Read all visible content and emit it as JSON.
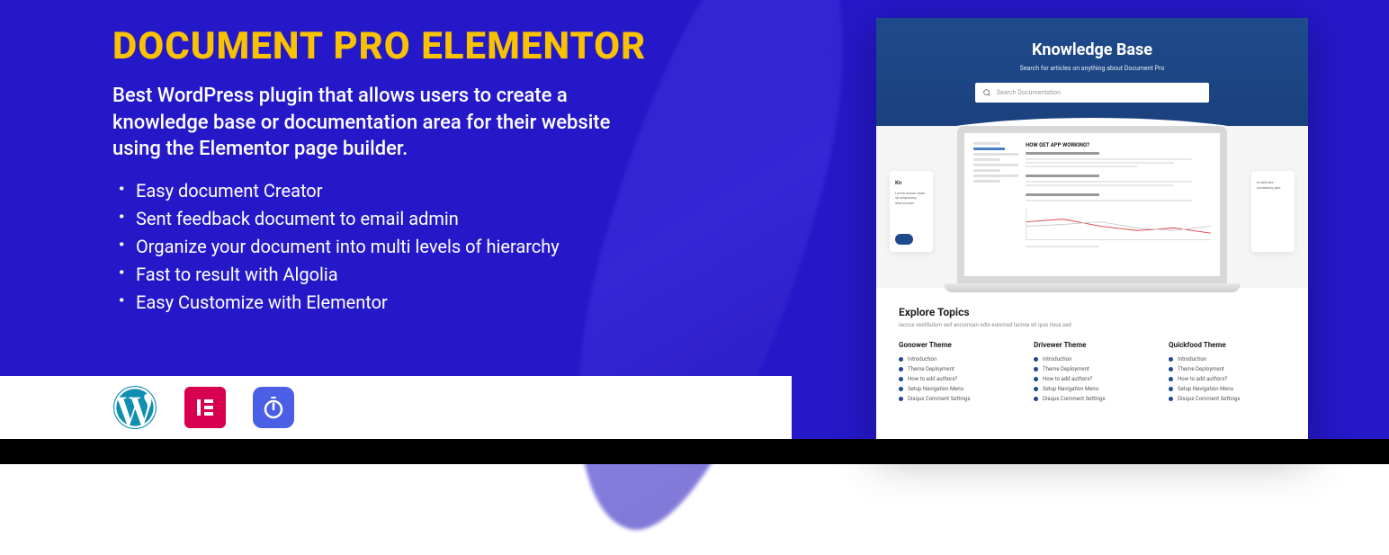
{
  "hero": {
    "title": "DOCUMENT PRO ELEMENTOR",
    "subtitle": "Best WordPress plugin that allows users to create  a knowledge base or documentation area for their website using the Elementor page builder.",
    "features": [
      "Easy document Creator",
      "Sent feedback document to email admin",
      "Organize your document into multi levels of hierarchy",
      "Fast to result with Algolia",
      "Easy Customize with Elementor"
    ]
  },
  "preview": {
    "kb_title": "Knowledge Base",
    "kb_subtitle": "Search for articles on anything about Document Pro",
    "search_placeholder": "Search Documentation",
    "left_card": {
      "title": "Kn",
      "text": "Lorem ipsum dolor sit adipiscing ullamcorper"
    },
    "right_card": {
      "text": "ts with the containing ges."
    },
    "article_title": "HOW GET APP WORKING?",
    "explore": {
      "title": "Explore Topics",
      "subtitle": "Iaccus vestibulum sed accumsan odio euismod lacinia sit quis risus sed",
      "columns": [
        {
          "title": "Gonower Theme",
          "items": [
            "Introduction",
            "Theme Deployment",
            "How to add authors?",
            "Setup Navigation Menu",
            "Disqus Comment Settings"
          ]
        },
        {
          "title": "Drivewer Theme",
          "items": [
            "Introduction",
            "Theme Deployment",
            "How to add authors?",
            "Setup Navigation Menu",
            "Disqus Comment Settings"
          ]
        },
        {
          "title": "Quickfood Theme",
          "items": [
            "Introduction",
            "Theme Deployment",
            "How to add authors?",
            "Setup Navigation Menu",
            "Disqus Comment Settings"
          ]
        }
      ]
    }
  }
}
